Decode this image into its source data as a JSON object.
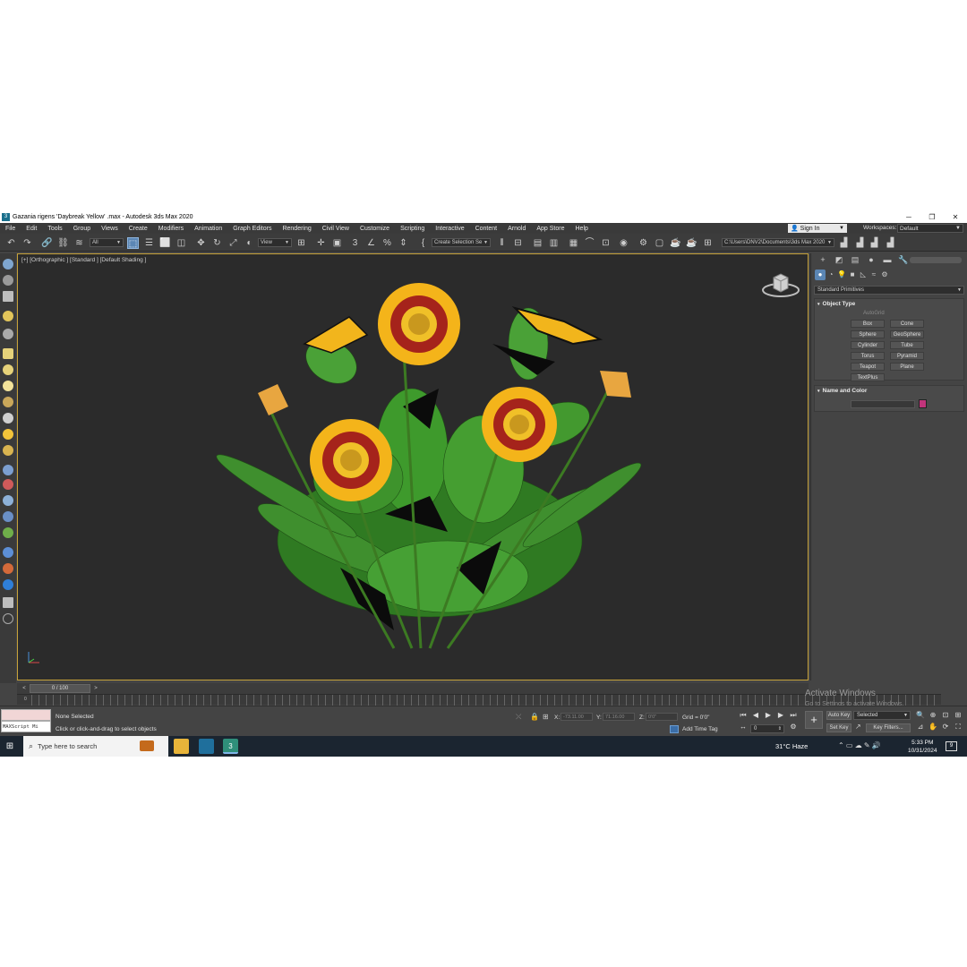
{
  "window": {
    "title": "Gazania rigens 'Daybreak Yellow' .max - Autodesk 3ds Max 2020",
    "app_icon_glyph": "3",
    "controls": [
      "─",
      "❐",
      "✕"
    ]
  },
  "menu": {
    "items": [
      "File",
      "Edit",
      "Tools",
      "Group",
      "Views",
      "Create",
      "Modifiers",
      "Animation",
      "Graph Editors",
      "Rendering",
      "Civil View",
      "Customize",
      "Scripting",
      "Interactive",
      "Content",
      "Arnold",
      "App Store",
      "Help"
    ],
    "sign_in": "Sign In",
    "workspaces_label": "Workspaces:",
    "workspace_value": "Default"
  },
  "toolbar": {
    "selection_filter": "All",
    "ref_coord": "View",
    "named_selection": "Create Selection Se",
    "project_path": "C:\\Users\\DNV2\\Documents\\3ds Max 2020"
  },
  "viewport": {
    "label": "[+] [Orthographic ] [Standard ] [Default Shading ]"
  },
  "command_panel": {
    "category": "Standard Primitives",
    "object_type_title": "Object Type",
    "autogrid": "AutoGrid",
    "buttons": [
      "Box",
      "Cone",
      "Sphere",
      "GeoSphere",
      "Cylinder",
      "Tube",
      "Torus",
      "Pyramid",
      "Teapot",
      "Plane",
      "TextPlus"
    ],
    "name_color_title": "Name and Color",
    "object_color": "#c2347b"
  },
  "timeline": {
    "frame_display": "0 / 100",
    "first_tick": "0"
  },
  "watermark": {
    "title": "Activate Windows",
    "subtitle": "Go to Settings to activate Windows."
  },
  "status": {
    "maxscript_label": "MAXScript Mi",
    "selection": "None Selected",
    "prompt": "Click or click-and-drag to select objects",
    "x_label": "X:",
    "y_label": "Y:",
    "z_label": "Z:",
    "x_value": "-73.11.00",
    "y_value": "71.16.00",
    "z_value": "0'0\"",
    "grid": "Grid = 0'0\"",
    "add_time_tag": "Add Time Tag",
    "auto_key": "Auto Key",
    "set_key": "Set Key",
    "key_mode": "Selected",
    "key_filters": "Key Filters...",
    "current_frame": "0"
  },
  "taskbar": {
    "search_placeholder": "Type here to search",
    "weather": "31°C  Haze",
    "time": "5:33 PM",
    "date": "10/31/2024",
    "notifications": "9"
  }
}
